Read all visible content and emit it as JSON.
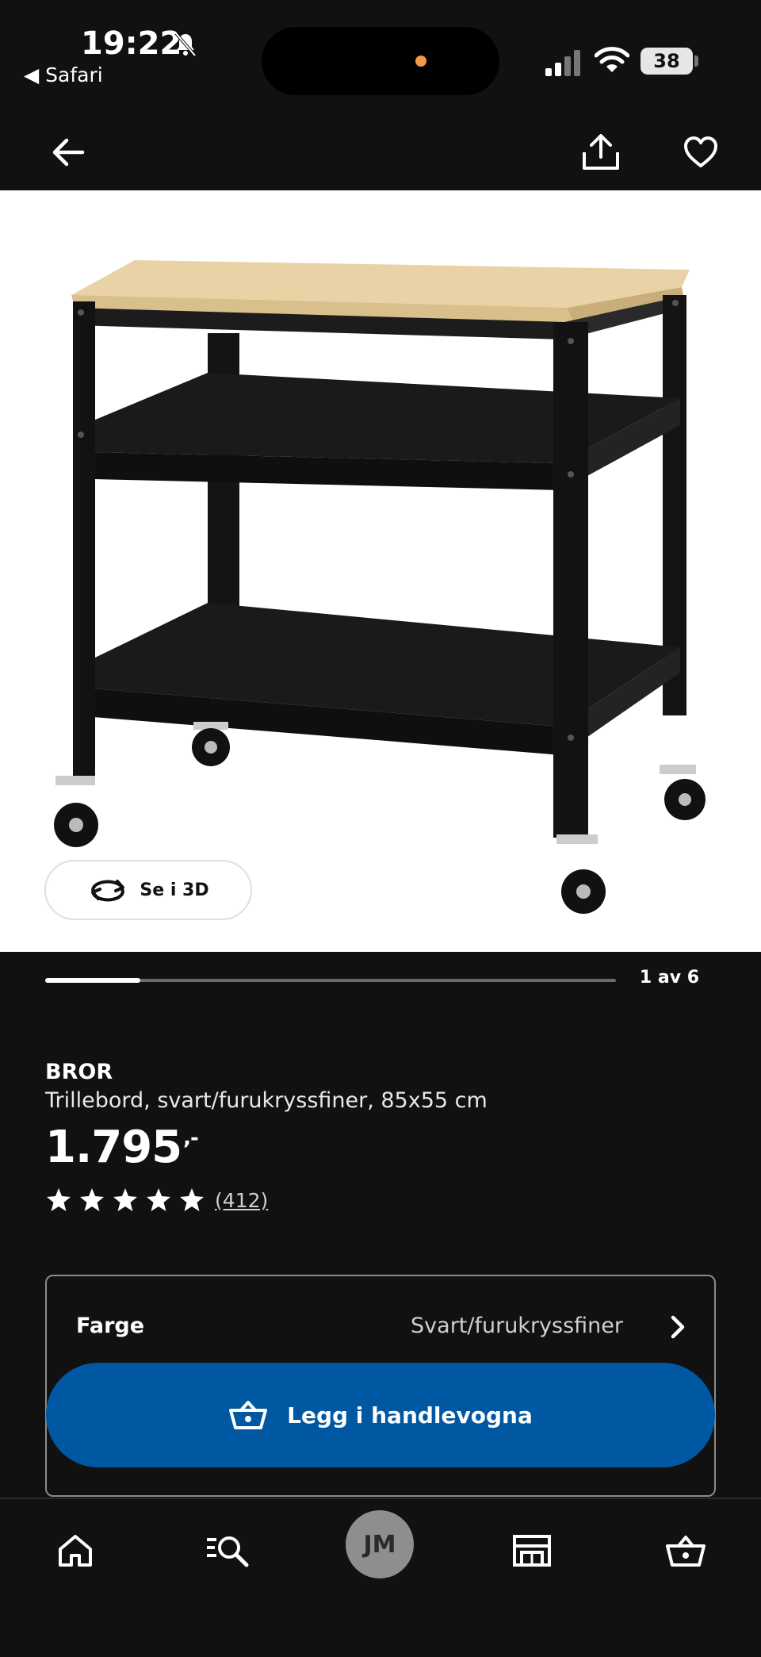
{
  "status_bar": {
    "time": "19:22",
    "back_app": "◀ Safari",
    "battery": "38"
  },
  "toolbar": {
    "back_icon": "arrow-left-icon",
    "share_icon": "share-icon",
    "favorite_icon": "heart-icon"
  },
  "gallery": {
    "see_3d_label": "Se i 3D",
    "counter": "1 av 6",
    "current_image": 1,
    "total_images": 6
  },
  "product": {
    "name": "BROR",
    "description": "Trillebord, svart/furukryssfiner, 85x55 cm",
    "price": "1.795",
    "price_suffix": ",-",
    "rating": 5,
    "review_count": "(412)"
  },
  "options": {
    "color_label": "Farge",
    "color_value": "Svart/furukryssfiner"
  },
  "cart": {
    "button_label": "Legg i handlevogna"
  },
  "tabbar": {
    "avatar_initials": "JM",
    "items": [
      "home-icon",
      "search-icon",
      "avatar",
      "store-icon",
      "basket-icon"
    ]
  },
  "colors": {
    "background": "#111111",
    "accent_blue": "#0058a3",
    "wood": "#e9d3a6"
  }
}
